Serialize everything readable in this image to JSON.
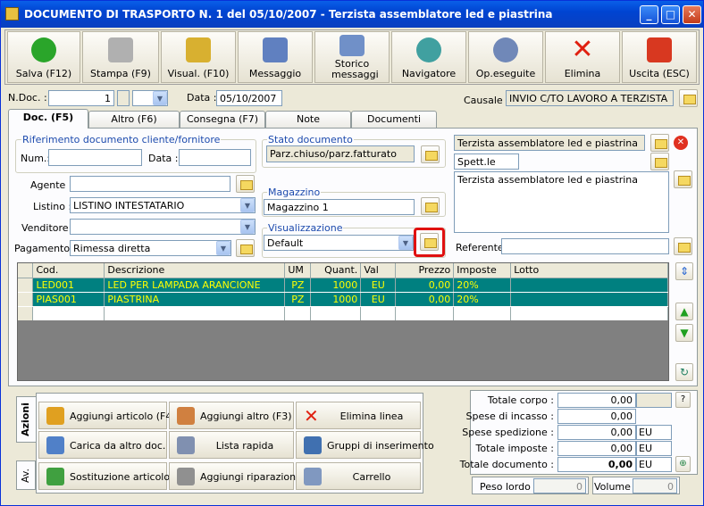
{
  "window": {
    "title": "DOCUMENTO DI TRASPORTO N. 1   del 05/10/2007 - Terzista assemblatore led e piastrina"
  },
  "toolbar": {
    "buttons": [
      {
        "label": "Salva (F12)",
        "icon": "save-check-icon",
        "color": "#2aa52a"
      },
      {
        "label": "Stampa (F9)",
        "icon": "printer-icon",
        "color": "#a8a8a8"
      },
      {
        "label": "Visual. (F10)",
        "icon": "magic-wand-icon",
        "color": "#d8b030"
      },
      {
        "label": "Messaggio",
        "icon": "message-pen-icon",
        "color": "#6080c0"
      },
      {
        "label": "Storico messaggi",
        "icon": "message-history-icon",
        "color": "#7090c8"
      },
      {
        "label": "Navigatore",
        "icon": "navigator-icon",
        "color": "#40a0a0"
      },
      {
        "label": "Op.eseguite",
        "icon": "gears-icon",
        "color": "#7088b8"
      },
      {
        "label": "Elimina",
        "icon": "delete-x-icon",
        "color": "#e02010"
      },
      {
        "label": "Uscita (ESC)",
        "icon": "exit-icon",
        "color": "#d83820"
      }
    ]
  },
  "header": {
    "ndoc_label": "N.Doc. :",
    "ndoc_value": "1",
    "data_label": "Data :",
    "data_value": "05/10/2007",
    "causale_label": "Causale :",
    "causale_value": "INVIO C/TO LAVORO A TERZISTA"
  },
  "tabs": [
    "Doc. (F5)",
    "Altro (F6)",
    "Consegna (F7)",
    "Note",
    "Documenti"
  ],
  "riferimento": {
    "title": "Riferimento documento cliente/fornitore",
    "num_label": "Num.:",
    "num_value": "",
    "data_label": "Data :",
    "data_value": ""
  },
  "stato": {
    "title": "Stato documento",
    "value": "Parz.chiuso/parz.fatturato"
  },
  "magazzino": {
    "title": "Magazzino",
    "value": "Magazzino 1"
  },
  "visualizzazione": {
    "title": "Visualizzazione",
    "value": "Default"
  },
  "fields": {
    "agente_label": "Agente :",
    "agente_value": "",
    "listino_label": "Listino :",
    "listino_value": "LISTINO INTESTATARIO",
    "venditore_label": "Venditore :",
    "venditore_value": "",
    "pagamento_label": "Pagamento :",
    "pagamento_value": "Rimessa diretta"
  },
  "cliente": {
    "name": "Terzista assemblatore led e piastrina",
    "salutation": "Spett.le",
    "address": "Terzista assemblatore led e piastrina",
    "referente_label": "Referente",
    "referente_value": ""
  },
  "grid": {
    "headers": [
      "Cod.",
      "Descrizione",
      "UM",
      "Quant.",
      "Val",
      "Prezzo",
      "Imposte",
      "Lotto"
    ],
    "rows": [
      [
        "LED001",
        "LED PER LAMPADA ARANCIONE",
        "PZ",
        "1000",
        "EU",
        "0,00",
        "20%",
        ""
      ],
      [
        "PIAS001",
        "PIASTRINA",
        "PZ",
        "1000",
        "EU",
        "0,00",
        "20%",
        ""
      ]
    ]
  },
  "side_tabs": {
    "azioni": "Azioni",
    "av": "Av."
  },
  "actions": [
    {
      "label": "Aggiungi articolo (F4)",
      "icon": "add-article-icon"
    },
    {
      "label": "Aggiungi altro (F3)",
      "icon": "add-other-icon"
    },
    {
      "label": "Elimina linea",
      "icon": "delete-line-icon"
    },
    {
      "label": "Carica da altro doc.",
      "icon": "load-document-icon"
    },
    {
      "label": "Lista rapida",
      "icon": "quick-list-icon"
    },
    {
      "label": "Gruppi di inserimento",
      "icon": "insert-groups-icon"
    },
    {
      "label": "Sostituzione articolo",
      "icon": "replace-article-icon"
    },
    {
      "label": "Aggiungi riparazione",
      "icon": "repair-icon"
    },
    {
      "label": "Carrello",
      "icon": "cart-icon"
    }
  ],
  "totals": {
    "corpo_label": "Totale corpo :",
    "corpo_value": "0,00",
    "help": "?",
    "incasso_label": "Spese di incasso :",
    "incasso_value": "0,00",
    "spedizione_label": "Spese spedizione :",
    "spedizione_value": "0,00",
    "spedizione_unit": "EU",
    "imposte_label": "Totale imposte :",
    "imposte_value": "0,00",
    "imposte_unit": "EU",
    "documento_label": "Totale documento :",
    "documento_value": "0,00",
    "documento_unit": "EU"
  },
  "weights": {
    "lordo_label": "Peso lordo :",
    "lordo_value": "0",
    "volume_label": "Volume :",
    "volume_value": "0"
  }
}
